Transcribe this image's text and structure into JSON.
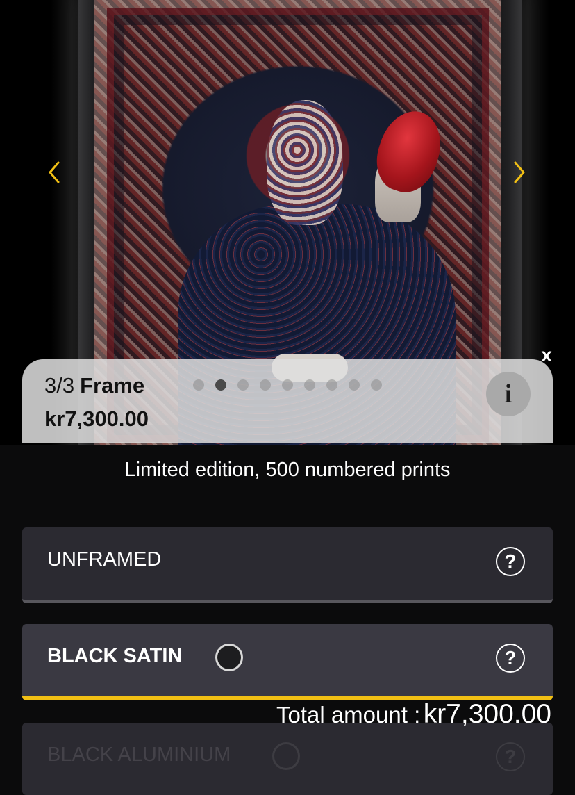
{
  "artwork": {
    "prev_icon": "chevron-left-icon",
    "next_icon": "chevron-right-icon",
    "close_label": "x"
  },
  "info_card": {
    "step": "3/3",
    "title": "Frame",
    "price": "kr7,300.00",
    "info_label": "i",
    "pager": {
      "total": 9,
      "active_index": 1
    }
  },
  "edition": "Limited edition, 500 numbered prints",
  "options": [
    {
      "label": "UNFRAMED",
      "help": "?",
      "selected": false
    },
    {
      "label": "BLACK SATIN",
      "help": "?",
      "selected": true,
      "swatch_color": "#1d1d1f"
    },
    {
      "label": "BLACK ALUMINIUM",
      "help": "?",
      "selected": false
    }
  ],
  "total": {
    "label": "Total amount :",
    "value": "kr7,300.00"
  },
  "colors": {
    "accent": "#f2c014",
    "background": "#0b0b0c",
    "card": "#2b2a31",
    "selected_card": "#3a3942"
  }
}
